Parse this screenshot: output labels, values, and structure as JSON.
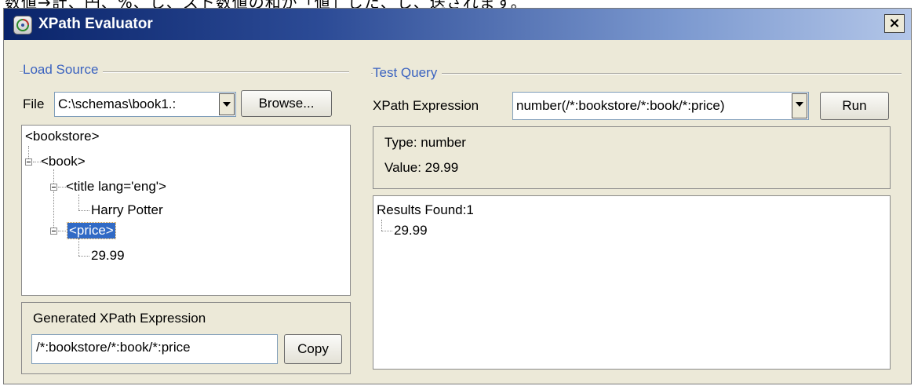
{
  "top_strip_text": "数値→計、円、%、し、スト数値の和が「値」した、し、送されます。",
  "window": {
    "title": "XPath Evaluator",
    "icon": "xpath-app-icon",
    "close_glyph": "×"
  },
  "load_source": {
    "group_label": "Load Source",
    "file_label": "File",
    "file_value": "C:\\schemas\\book1.:",
    "browse_label": "Browse...",
    "tree": {
      "root": "<bookstore>",
      "book": "<book>",
      "title": "<title lang='eng'>",
      "title_text": "Harry Potter",
      "price": "<price>",
      "price_text": "29.99"
    }
  },
  "generated": {
    "label": "Generated XPath Expression",
    "value": "/*:bookstore/*:book/*:price",
    "copy_label": "Copy"
  },
  "test_query": {
    "group_label": "Test Query",
    "expr_label": "XPath Expression",
    "expr_value": "number(/*:bookstore/*:book/*:price)",
    "run_label": "Run",
    "type_line": "Type: number",
    "value_line": "Value: 29.99",
    "results_label": "Results Found:1",
    "result_item": "29.99"
  }
}
